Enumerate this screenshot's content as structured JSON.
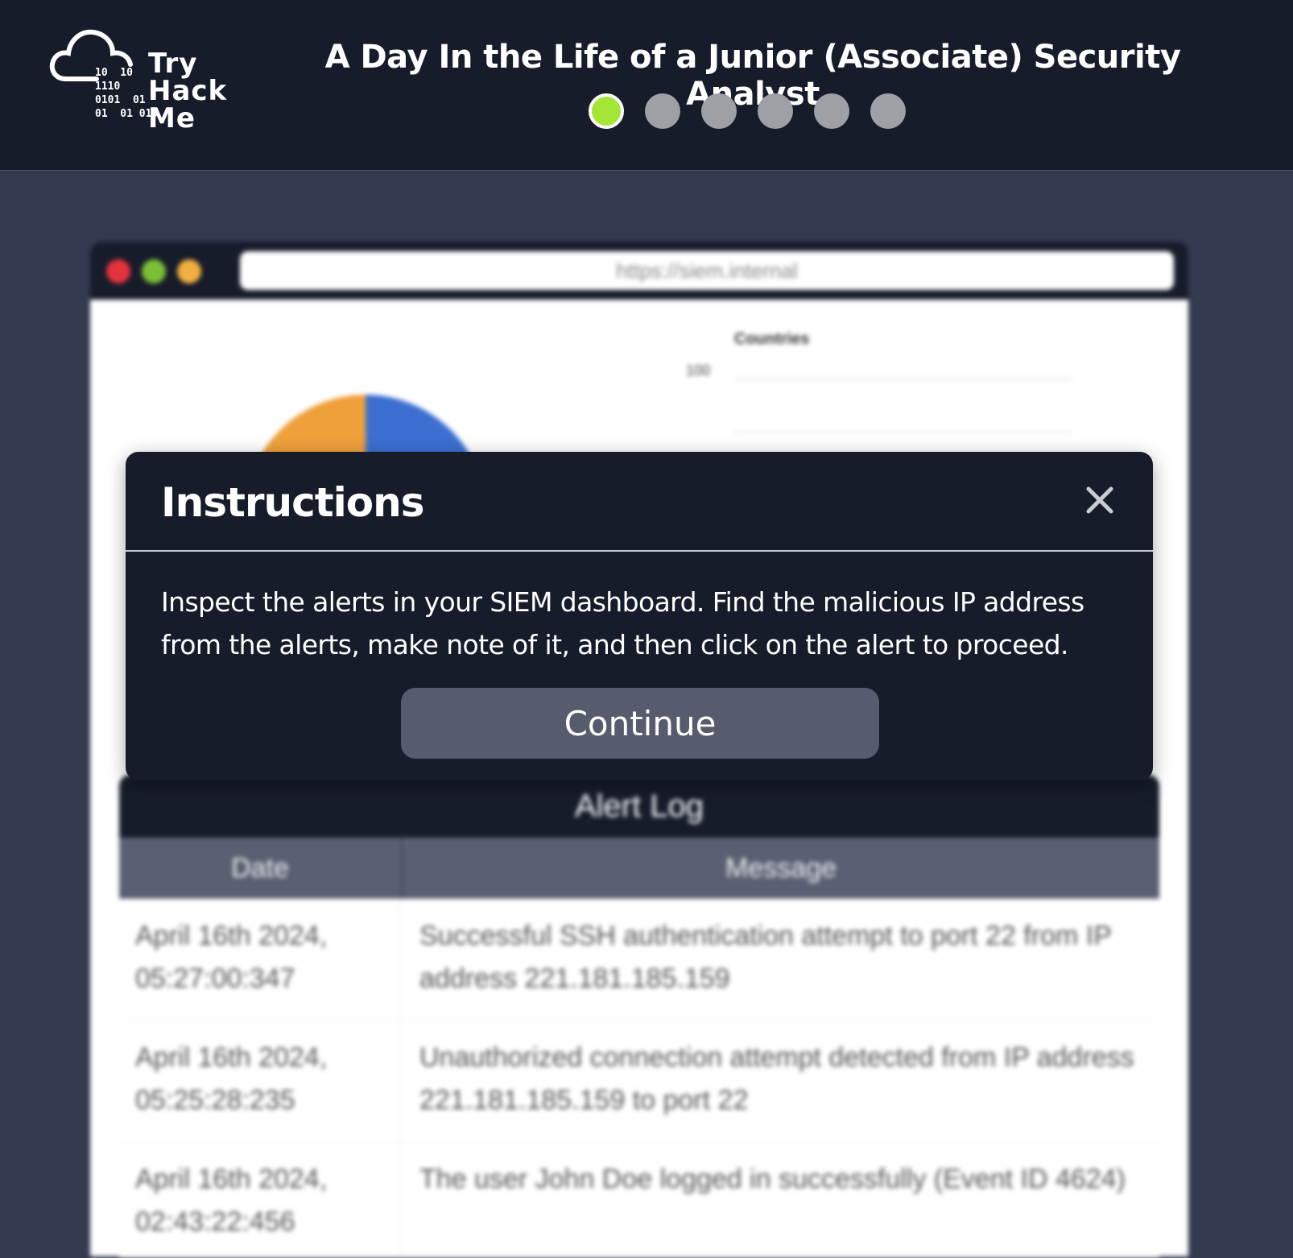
{
  "header": {
    "logo": {
      "bits": "10  10\n1110\n0101  01\n01  01 010",
      "line1": "Try",
      "line2": "Hack",
      "line3": "Me"
    },
    "title": "A Day In the Life of a Junior (Associate) Security Analyst",
    "progress": {
      "total": 6,
      "current": 1,
      "active_color": "#a3e635",
      "inactive_color": "#9ea0a6"
    }
  },
  "siem": {
    "url": "https://siem.internal",
    "countries_title": "Countries",
    "countries_tick": "100",
    "pie_colors": [
      "#f0a03a",
      "#3c6fd1"
    ],
    "alert_log": {
      "title": "Alert Log",
      "columns": [
        "Date",
        "Message"
      ],
      "rows": [
        {
          "date": "April 16th 2024, 05:27:00:347",
          "message": "Successful SSH authentication attempt to port 22 from IP address 221.181.185.159"
        },
        {
          "date": "April 16th 2024, 05:25:28:235",
          "message": "Unauthorized connection attempt detected from IP address 221.181.185.159 to port 22"
        },
        {
          "date": "April 16th 2024, 02:43:22:456",
          "message": "The user John Doe logged in successfully (Event ID 4624)"
        }
      ]
    }
  },
  "modal": {
    "title": "Instructions",
    "body": "Inspect the alerts in your SIEM dashboard. Find the malicious IP address from the alerts, make note of it, and then click on the alert to proceed.",
    "continue_label": "Continue"
  }
}
